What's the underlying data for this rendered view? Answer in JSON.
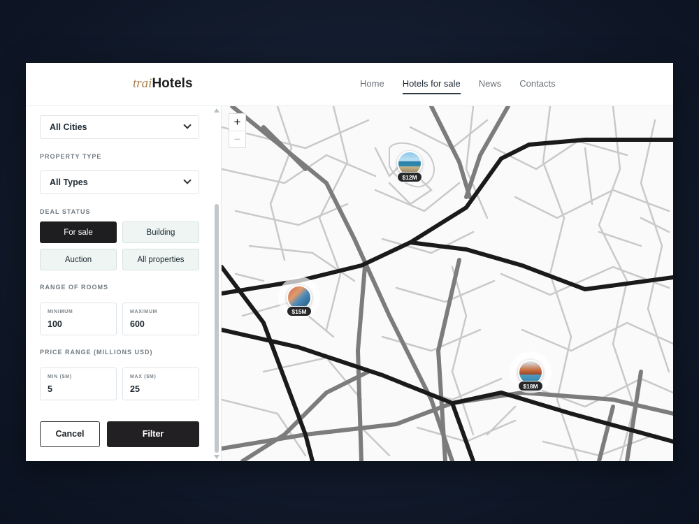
{
  "brand": {
    "prefix": "trai",
    "name": "Hotels"
  },
  "nav": [
    {
      "label": "Home",
      "active": false
    },
    {
      "label": "Hotels for sale",
      "active": true
    },
    {
      "label": "News",
      "active": false
    },
    {
      "label": "Contacts",
      "active": false
    }
  ],
  "filters": {
    "city": {
      "value": "All Cities"
    },
    "property_type": {
      "label": "PROPERTY TYPE",
      "value": "All Types"
    },
    "deal_status": {
      "label": "DEAL STATUS",
      "options": [
        "For sale",
        "Building",
        "Auction",
        "All properties"
      ],
      "selected": "For sale"
    },
    "rooms": {
      "label": "RANGE OF ROOMS",
      "min_label": "MINIMUM",
      "min_value": "100",
      "max_label": "MAXIMUM",
      "max_value": "600"
    },
    "price": {
      "label": "PRICE RANGE (MILLIONS USD)",
      "min_label": "MIN ($M)",
      "min_value": "5",
      "max_label": "MAX ($M)",
      "max_value": "25"
    },
    "cancel_label": "Cancel",
    "filter_label": "Filter"
  },
  "map": {
    "zoom_in": "+",
    "zoom_out": "−",
    "pins": [
      {
        "price": "$12M"
      },
      {
        "price": "$15M"
      },
      {
        "price": "$18M"
      }
    ]
  },
  "colors": {
    "primary_dark": "#1e1d1f",
    "chip_bg": "#eef5f3",
    "brand_accent": "#a9824f"
  }
}
